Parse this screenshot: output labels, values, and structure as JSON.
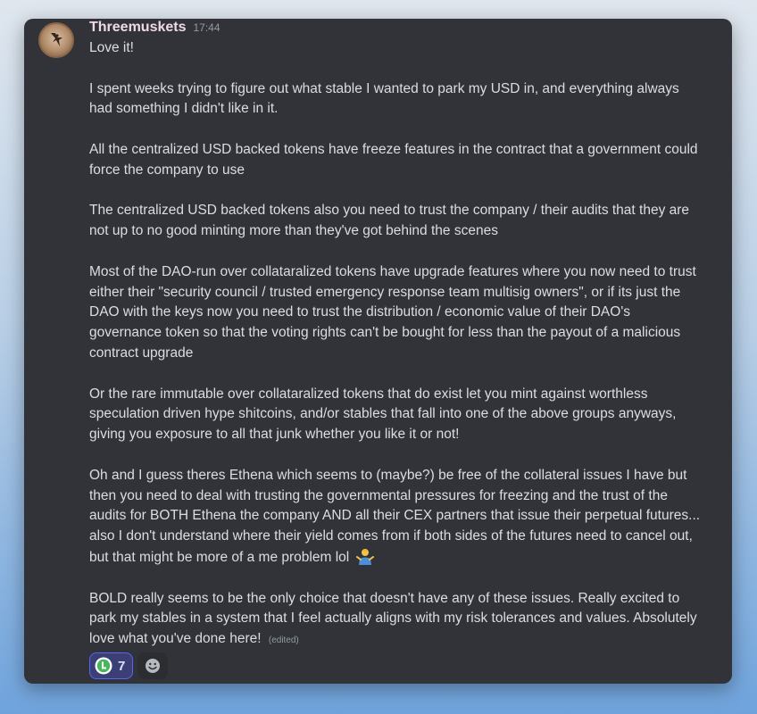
{
  "message": {
    "username": "Threemuskets",
    "timestamp": "17:44",
    "paragraphs": [
      "Love it!",
      "I spent weeks trying to figure out what stable I wanted to park my USD in, and everything always had something I didn't like in it.",
      "All the centralized USD backed tokens have freeze features in the contract that a government could force the company to use",
      "The centralized USD backed tokens also you need to trust the company / their audits that they are not up to no good minting more than they've got behind the scenes",
      "Most of the DAO-run over collataralized tokens have upgrade features where you now need to trust either their \"security council / trusted emergency response team multisig owners\", or if its just the DAO with the keys now you need to trust the distribution / economic value of their DAO's governance token so that the voting rights can't be bought for less than the payout of a malicious contract upgrade",
      "Or the rare immutable over collataralized tokens that do exist let you mint against worthless speculation driven hype shitcoins, and/or stables that fall into one of the above groups anyways, giving you exposure to all that junk whether you like it or not!",
      "Oh and I guess theres Ethena which seems to (maybe?) be free of the collateral issues I have but then you need to deal with trusting the governmental pressures for freezing and the trust of the audits for BOTH Ethena the company AND all their CEX partners that issue their perpetual futures... also I don't understand where their yield comes from if both sides of the futures need to cancel out, but that might be more of a me problem lol",
      "BOLD really seems to be the only choice that doesn't have any of these issues. Really excited to park my stables in a system that I feel actually aligns with my risk tolerances and values. Absolutely love what you've done here!"
    ],
    "edited_label": "(edited)",
    "shrug_emoji": "person-shrugging-emoji"
  },
  "reactions": [
    {
      "icon": "liquity-logo-icon",
      "count": "7",
      "active": true
    },
    {
      "icon": "add-reaction-icon",
      "count": "",
      "active": false
    }
  ],
  "colors": {
    "background_top": "#dfe6ee",
    "background_bottom": "#6fa3dc",
    "card": "#313338",
    "username": "#f0d9e8",
    "text": "#dbdee1",
    "muted": "#949ba4",
    "reaction_active_bg": "#3b3f76",
    "reaction_active_border": "#5865f2"
  }
}
